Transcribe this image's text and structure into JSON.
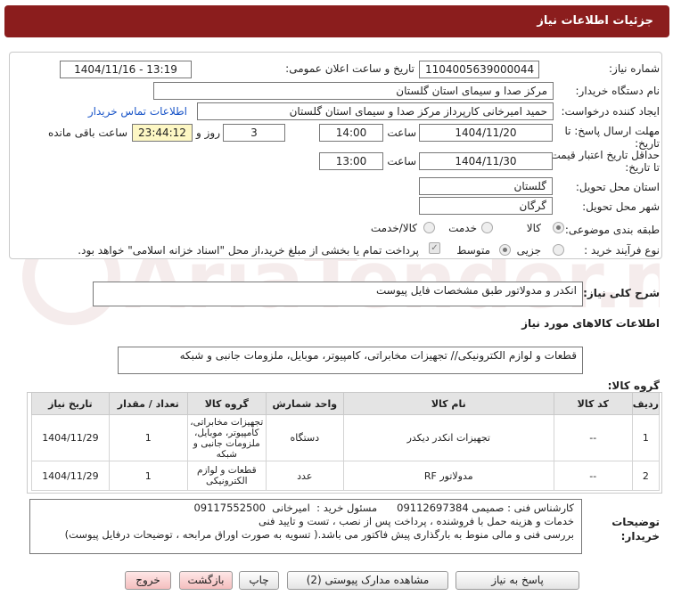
{
  "header": {
    "title": "جزئیات اطلاعات نیاز"
  },
  "fields": {
    "need_number_label": "شماره نیاز:",
    "need_number": "1104005639000044",
    "announce_label": "تاریخ و ساعت اعلان عمومی:",
    "announce_value": "1404/11/16 - 13:19",
    "buyer_org_label": "نام دستگاه خریدار:",
    "buyer_org": "مرکز صدا و سیمای استان گلستان",
    "requester_label": "ایجاد کننده درخواست:",
    "requester": "حمید امیرخانی کارپرداز مرکز صدا و سیمای استان گلستان",
    "contact_link": "اطلاعات تماس خریدار",
    "reply_deadline_label": "مهلت ارسال پاسخ: تا تاریخ:",
    "reply_date": "1404/11/20",
    "time_label": "ساعت",
    "reply_time": "14:00",
    "days_value": "3",
    "days_label": "روز و",
    "remaining_time": "23:44:12",
    "remaining_label": "ساعت باقی مانده",
    "price_validity_label": "حداقل تاریخ اعتبار قیمت: تا تاریخ:",
    "validity_date": "1404/11/30",
    "validity_time": "13:00",
    "province_label": "استان محل تحویل:",
    "province": "گلستان",
    "city_label": "شهر محل تحویل:",
    "city": "گرگان",
    "category_label": "طبقه بندی موضوعی:",
    "cat_goods": "کالا",
    "cat_service": "خدمت",
    "cat_goods_service": "کالا/خدمت",
    "process_label": "نوع فرآیند خرید :",
    "proc_partial": "جزیی",
    "proc_medium": "متوسط",
    "payment_note": "پرداخت تمام یا بخشی از مبلغ خرید،از محل \"اسناد خزانه اسلامی\" خواهد بود."
  },
  "summary": {
    "label": "شرح کلی نیاز:",
    "text": "انکدر و مدولاتور طبق مشخصات فایل پیوست"
  },
  "goods_info_title": "اطلاعات کالاهای مورد نیاز",
  "goods_group": {
    "label": "گروه کالا:",
    "text": "قطعات و لوازم الکترونیکی// تجهیزات مخابراتی، کامپیوتر، موبایل، ملزومات جانبی و شبکه"
  },
  "table": {
    "headers": [
      "ردیف",
      "کد کالا",
      "نام کالا",
      "واحد شمارش",
      "گروه کالا",
      "تعداد / مقدار",
      "تاریخ نیاز"
    ],
    "rows": [
      [
        "1",
        "--",
        "تجهیزات انکدر دیکدر",
        "دستگاه",
        "تجهیزات مخابراتی، کامپیوتر، موبایل، ملزومات جانبی و شبکه",
        "1",
        "1404/11/29"
      ],
      [
        "2",
        "--",
        "مدولاتور RF",
        "عدد",
        "قطعات و لوازم الکترونیکی",
        "1",
        "1404/11/29"
      ]
    ]
  },
  "buyer_desc": {
    "label": "توضیحات خریدار:",
    "line1": "کارشناس فنی : صمیمی 09112697384      مسئول خرید :  امیرخانی  09117552500",
    "line2": "خدمات و هزینه حمل با فروشنده ،  پرداخت پس از نصب ، تست و تایید فنی",
    "line3": "بررسی فنی و مالی منوط به بارگذاری پیش فاکتور می باشد.( تسویه به صورت اوراق مرابحه ، توضیحات درفایل پیوست)"
  },
  "buttons": {
    "reply": "پاسخ به نیاز",
    "attachments": "مشاهده مدارک پیوستی (2)",
    "print": "چاپ",
    "back": "بازگشت",
    "exit": "خروج"
  },
  "watermark": "AriaTender.neT",
  "colors": {
    "header": "#8b1d1d",
    "link": "#1a55c8",
    "highlight": "#fdf7c4"
  }
}
